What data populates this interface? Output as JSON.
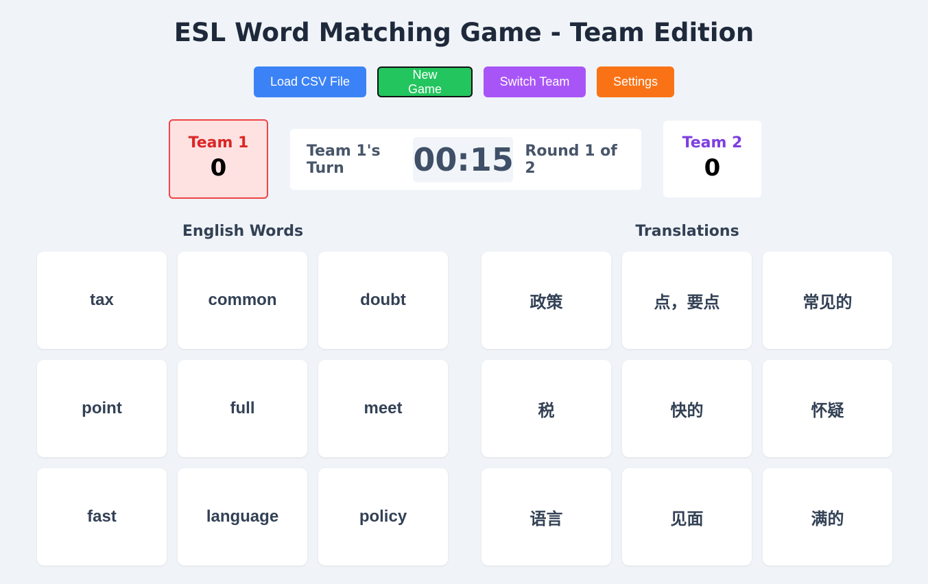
{
  "title": "ESL Word Matching Game - Team Edition",
  "toolbar": {
    "load_csv": "Load CSV File",
    "new_game": "New Game",
    "switch_team": "Switch Team",
    "settings": "Settings"
  },
  "teams": [
    {
      "name": "Team 1",
      "score": "0",
      "color": "#dc2626",
      "active": true
    },
    {
      "name": "Team 2",
      "score": "0",
      "color": "#7e3fe0",
      "active": false
    }
  ],
  "status": {
    "turn": "Team 1's Turn",
    "timer": "00:15",
    "round": "Round 1 of 2"
  },
  "english": {
    "heading": "English Words",
    "words": [
      "tax",
      "common",
      "doubt",
      "point",
      "full",
      "meet",
      "fast",
      "language",
      "policy"
    ]
  },
  "translations": {
    "heading": "Translations",
    "words": [
      "政策",
      "点，要点",
      "常见的",
      "税",
      "快的",
      "怀疑",
      "语言",
      "见面",
      "满的"
    ]
  },
  "colors": {
    "background": "#f0f4f8",
    "load_csv": "#3b82f6",
    "new_game": "#22c55e",
    "switch_team": "#a855f7",
    "settings": "#f97316"
  }
}
